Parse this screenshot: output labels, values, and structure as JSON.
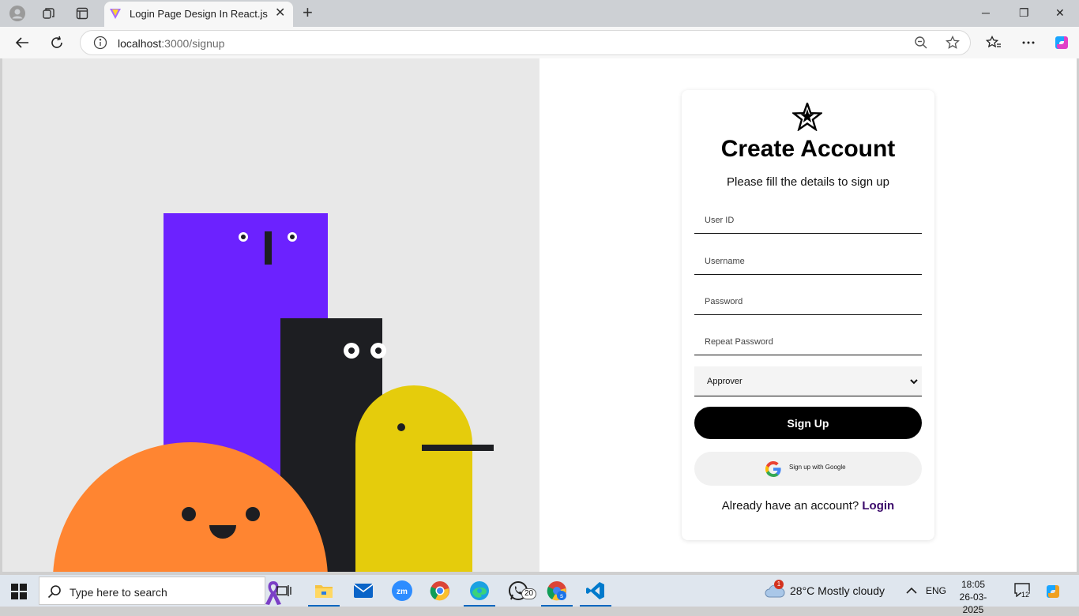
{
  "browser": {
    "tab_title": "Login Page Design In React.js",
    "url_host": "localhost",
    "url_path": ":3000/signup"
  },
  "left_illustration": {
    "colors": {
      "background": "#e8e8e8",
      "purple": "#6c22ff",
      "black": "#1d1e22",
      "orange": "#ff8531",
      "yellow": "#e5cc0c"
    }
  },
  "signup_card": {
    "title": "Create Account",
    "subtitle": "Please fill the details to sign up",
    "fields": {
      "user_id_placeholder": "User ID",
      "username_placeholder": "Username",
      "password_placeholder": "Password",
      "repeat_password_placeholder": "Repeat Password"
    },
    "role_select": {
      "value": "Approver"
    },
    "signup_button": "Sign Up",
    "google_button": "Sign up with Google",
    "already_text": "Already have an account?",
    "login_link": "Login",
    "colors": {
      "primary": "#000000",
      "link": "#3b0a6b"
    }
  },
  "taskbar": {
    "search_placeholder": "Type here to search",
    "whatsapp_badge": "20",
    "weather_alert": "1",
    "weather": "28°C  Mostly cloudy",
    "language": "ENG",
    "time": "18:05",
    "date": "26-03-2025",
    "notification_count": "12"
  }
}
